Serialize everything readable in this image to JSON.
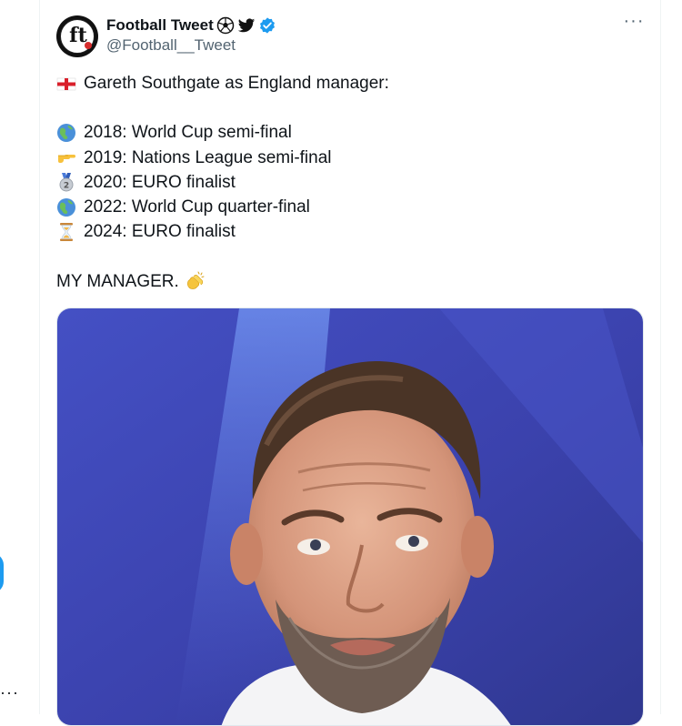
{
  "tweet": {
    "display_name": "Football Tweet",
    "handle": "@Football__Tweet",
    "avatar_text": "ft",
    "more_label": "···",
    "lines": [
      "Gareth Southgate as England manager:",
      "2018: World Cup semi-final",
      "2019: Nations League semi-final",
      "2020: EURO finalist",
      "2022: World Cup quarter-final",
      "2024: EURO finalist",
      "MY MANAGER."
    ],
    "name_icons": [
      "soccer-ball-icon",
      "twitter-bird-icon",
      "verified-badge-icon"
    ],
    "line_icons": [
      "england-flag-icon",
      "globe-icon",
      "pointing-hand-icon",
      "second-place-medal-icon",
      "globe-icon",
      "hourglass-icon",
      "clapping-hands-icon"
    ],
    "media": {
      "description_icon": "manager-photo"
    }
  },
  "left_rail": {
    "more_label": "···"
  },
  "colors": {
    "accent": "#1d9bf0",
    "secondary_text": "#536471",
    "text": "#0f1419",
    "photo_background": "#3f47b8"
  }
}
